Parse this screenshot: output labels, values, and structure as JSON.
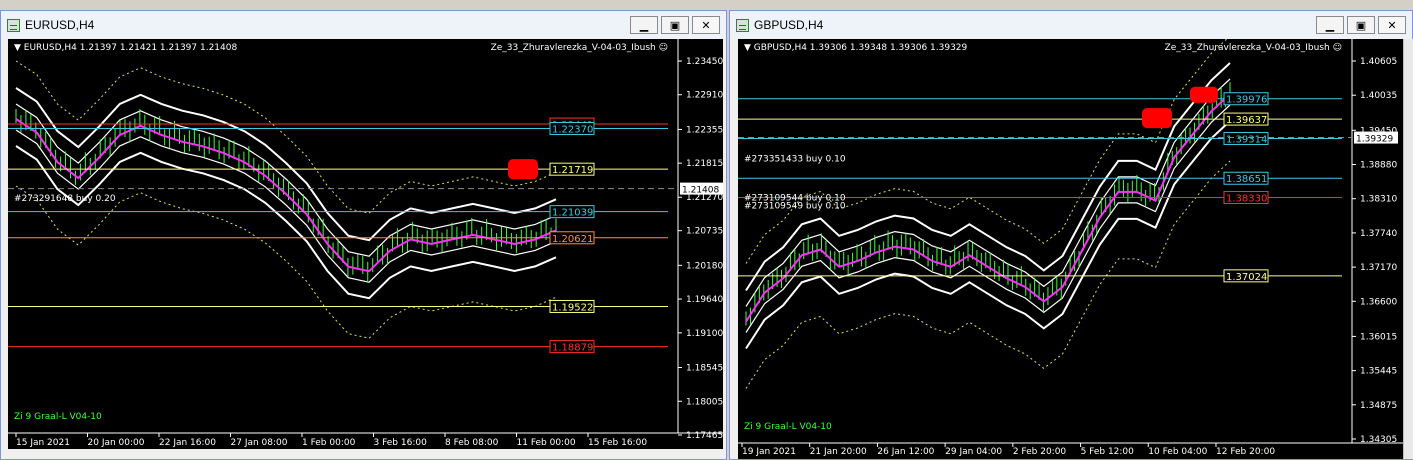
{
  "windows": [
    {
      "title": "EURUSD,H4",
      "info": "EURUSD,H4  1.21397 1.21421 1.21397 1.21408",
      "expert": "Ze_33_Zhuravlerezka_V-04-03_Ibush",
      "indicator_label": "Zi 9 Graal-L V04-10",
      "order_label": "#273291648 buy 0.20",
      "yaxis_ticks": [
        1.2345,
        1.2291,
        1.22355,
        1.21815,
        1.2127,
        1.20735,
        1.2018,
        1.1964,
        1.191,
        1.18545,
        1.18005,
        1.17465
      ],
      "xaxis_labels": [
        "15 Jan 2021",
        "20 Jan 00:00",
        "22 Jan 16:00",
        "27 Jan 08:00",
        "1 Feb 00:00",
        "3 Feb 16:00",
        "8 Feb 08:00",
        "11 Feb 00:00",
        "15 Feb 16:00"
      ],
      "current_price": "1.21408",
      "levels": [
        {
          "label": "1.22441",
          "value": 1.22441,
          "color": "#ff3030"
        },
        {
          "label": "1.22370",
          "value": 1.2237,
          "color": "#40c8e0"
        },
        {
          "label": "1.21719",
          "value": 1.21719,
          "color": "#ffff80"
        },
        {
          "label": "1.21039",
          "value": 1.21039,
          "color": "#40c8e0"
        },
        {
          "label": "1.20621",
          "value": 1.20621,
          "color": "#ff9040"
        },
        {
          "label": "1.19522",
          "value": 1.19522,
          "color": "#ffff80"
        },
        {
          "label": "1.18879",
          "value": 1.18879,
          "color": "#ff3030"
        }
      ]
    },
    {
      "title": "GBPUSD,H4",
      "info": "GBPUSD,H4  1.39306 1.39348 1.39306 1.39329",
      "expert": "Ze_33_Zhuravlerezka_V-04-03_Ibush",
      "indicator_label": "Zi 9 Graal-L V04-10",
      "order_labels": [
        "#273351433 buy 0.10",
        "#273109544 buy 0.10",
        "#273109549 buy 0.10"
      ],
      "yaxis_ticks": [
        1.40605,
        1.40035,
        1.3945,
        1.3888,
        1.3831,
        1.3774,
        1.3717,
        1.366,
        1.36015,
        1.35445,
        1.34875,
        1.34305
      ],
      "xaxis_labels": [
        "19 Jan 2021",
        "21 Jan 20:00",
        "26 Jan 12:00",
        "29 Jan 04:00",
        "2 Feb 20:00",
        "5 Feb 12:00",
        "10 Feb 04:00",
        "12 Feb 20:00"
      ],
      "current_price": "1.39329",
      "levels": [
        {
          "label": "1.39976",
          "value": 1.39976,
          "color": "#40c8e0"
        },
        {
          "label": "1.39637",
          "value": 1.39637,
          "color": "#ffff80"
        },
        {
          "label": "1.39314",
          "value": 1.39314,
          "color": "#40c8e0"
        },
        {
          "label": "1.38651",
          "value": 1.38651,
          "color": "#40c8e0"
        },
        {
          "label": "1.38330",
          "value": 1.3833,
          "color": "#ff3030"
        },
        {
          "label": "1.37024",
          "value": 1.37024,
          "color": "#ffff80"
        }
      ]
    }
  ],
  "colors": {
    "bg": "#000000",
    "candle": "#40ff40",
    "band": "#ffffff",
    "ma": "#ff30ff",
    "dotted": "#e0e060",
    "grid": "#ffffff"
  }
}
